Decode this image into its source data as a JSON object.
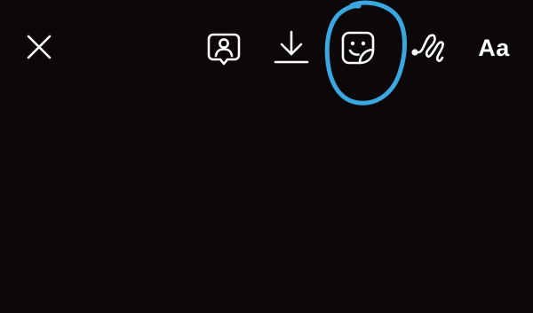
{
  "screen": {
    "background_color": "#0c0709"
  },
  "toolbar": {
    "icon_color": "#ffffff",
    "items": [
      {
        "id": "close",
        "icon": "close-icon"
      },
      {
        "id": "tag-people",
        "icon": "tag-person-icon"
      },
      {
        "id": "save",
        "icon": "download-icon"
      },
      {
        "id": "sticker",
        "icon": "sticker-icon"
      },
      {
        "id": "draw",
        "icon": "squiggle-draw-icon"
      },
      {
        "id": "text",
        "icon": "text-icon",
        "label": "Aa"
      }
    ]
  },
  "annotation": {
    "shape": "hand-drawn circle around sticker icon",
    "color": "#3aa7e0"
  }
}
